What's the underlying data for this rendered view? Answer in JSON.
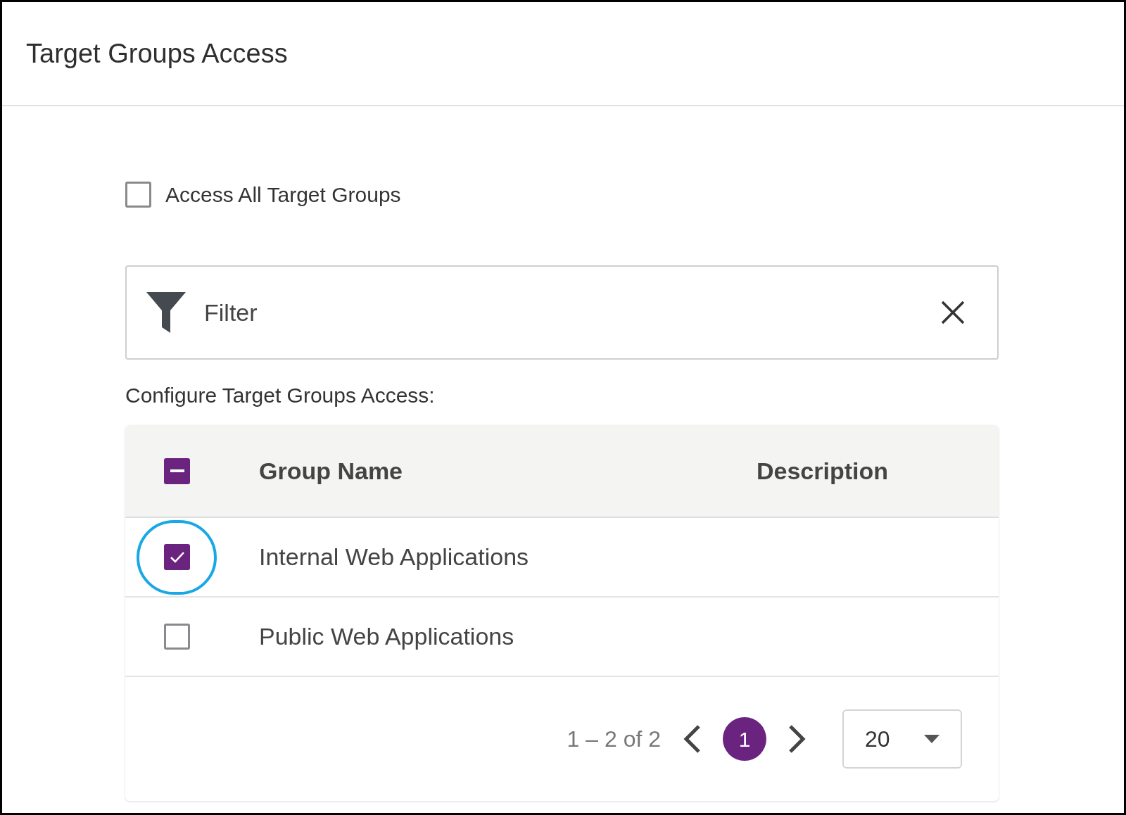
{
  "header": {
    "title": "Target Groups Access"
  },
  "access_all": {
    "label": "Access All Target Groups",
    "checked": false
  },
  "filter": {
    "placeholder": "Filter"
  },
  "table_label": "Configure Target Groups Access:",
  "table": {
    "select_all": {
      "indeterminate": true
    },
    "columns": [
      "Group Name",
      "Description"
    ],
    "rows": [
      {
        "group_name": "Internal Web Applications",
        "checked": true,
        "circled": true
      },
      {
        "group_name": "Public Web Applications",
        "checked": false,
        "circled": false
      }
    ]
  },
  "pagination": {
    "range": "1 – 2 of 2",
    "pages": [
      {
        "label": "1",
        "selected": true
      }
    ],
    "page_size": "20"
  }
}
